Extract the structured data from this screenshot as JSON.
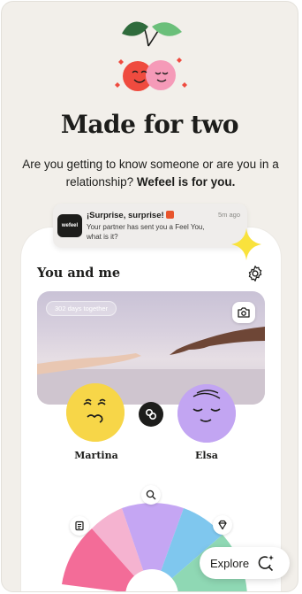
{
  "screen": {
    "headline": "Made for two",
    "subline_plain": "Are you getting to know someone or are you in a relationship? ",
    "subline_bold": "Wefeel is for you."
  },
  "notification": {
    "app_logo_text": "wefeel",
    "title": "¡Surprise, surprise!",
    "time": "5m ago",
    "body": "Your partner has sent you a Feel You, what is it?"
  },
  "app": {
    "section_title": "You and me",
    "days_together": "302 days together",
    "partners": [
      {
        "name": "Martina",
        "color": "#f7d648"
      },
      {
        "name": "Elsa",
        "color": "#c2a5f2"
      }
    ]
  },
  "wheel": {
    "segment_colors": [
      "#f36c98",
      "#f5b3d0",
      "#c5a6f3",
      "#7fc7ee",
      "#8fd8b4"
    ]
  },
  "explore": {
    "label": "Explore"
  },
  "colors": {
    "background": "#f2efea",
    "text": "#1d1d1b",
    "accent_yellow": "#f9e23c",
    "cherry_red": "#ef4b3f"
  },
  "icons": [
    "cherry-illustration-icon",
    "sparkle-icon",
    "gear-icon",
    "camera-icon",
    "link-icon",
    "search-icon",
    "journal-icon",
    "gem-icon",
    "explore-icon"
  ]
}
